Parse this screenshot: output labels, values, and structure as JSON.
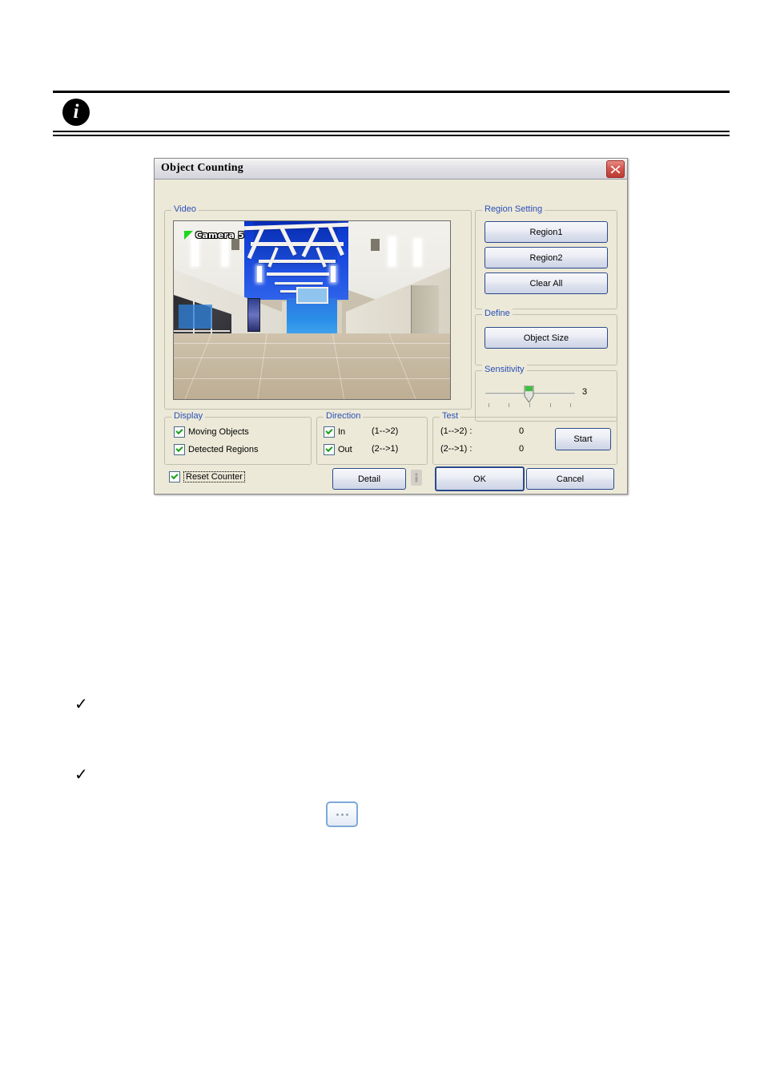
{
  "page": {
    "info_badge_glyph": "i",
    "bullet_glyph": "✓",
    "ellipsis_label": "..."
  },
  "dialog": {
    "title": "Object Counting",
    "close_icon": "close-icon",
    "video": {
      "group_label": "Video",
      "camera_label": "Camera 5",
      "play_icon": "play-triangle-icon"
    },
    "region_setting": {
      "group_label": "Region Setting",
      "buttons": [
        {
          "label": "Region1"
        },
        {
          "label": "Region2"
        },
        {
          "label": "Clear All"
        }
      ]
    },
    "define": {
      "group_label": "Define",
      "object_size_label": "Object Size"
    },
    "sensitivity": {
      "group_label": "Sensitivity",
      "value": "3",
      "min": 1,
      "max": 5,
      "ticks": 5
    },
    "display": {
      "group_label": "Display",
      "items": [
        {
          "label": "Moving Objects",
          "checked": true
        },
        {
          "label": "Detected Regions",
          "checked": true
        }
      ]
    },
    "direction": {
      "group_label": "Direction",
      "items": [
        {
          "label": "In",
          "arrow": "(1-->2)",
          "checked": true
        },
        {
          "label": "Out",
          "arrow": "(2-->1)",
          "checked": true
        }
      ]
    },
    "test": {
      "group_label": "Test",
      "rows": [
        {
          "label": "(1-->2) :",
          "value": "0"
        },
        {
          "label": "(2-->1) :",
          "value": "0"
        }
      ],
      "start_label": "Start"
    },
    "reset_counter": {
      "label": "Reset Counter",
      "checked": true
    },
    "footer": {
      "detail_label": "Detail",
      "ok_label": "OK",
      "cancel_label": "Cancel",
      "info_icon": "info-icon"
    },
    "colors": {
      "group_label": "#2a4fb8",
      "dialog_face": "#ece9d8",
      "button_border": "#2b4a8b",
      "check_mark": "#18a018",
      "close_button": "#bb3a32",
      "camera_triangle": "#1fd61f"
    }
  }
}
